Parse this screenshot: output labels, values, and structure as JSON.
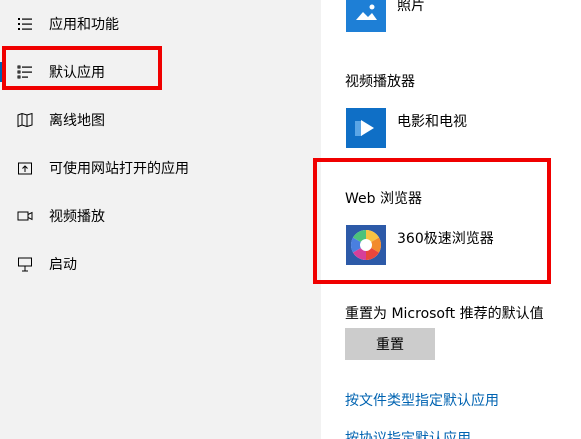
{
  "sidebar": {
    "items": [
      {
        "label": "应用和功能",
        "icon": "list-icon"
      },
      {
        "label": "默认应用",
        "icon": "default-apps-icon",
        "selected": true
      },
      {
        "label": "离线地图",
        "icon": "map-icon"
      },
      {
        "label": "可使用网站打开的应用",
        "icon": "open-website-icon"
      },
      {
        "label": "视频播放",
        "icon": "video-icon"
      },
      {
        "label": "启动",
        "icon": "startup-icon"
      }
    ]
  },
  "content": {
    "photos": {
      "app_label": "照片"
    },
    "video_player": {
      "section_label": "视频播放器",
      "app_label": "电影和电视"
    },
    "web_browser": {
      "section_label": "Web 浏览器",
      "app_label": "360极速浏览器"
    },
    "reset": {
      "label": "重置为 Microsoft 推荐的默认值",
      "button_label": "重置"
    },
    "links": {
      "by_file_type": "按文件类型指定默认应用",
      "by_protocol": "按协议指定默认应用"
    }
  },
  "colors": {
    "accent": "#0063b1",
    "highlight_box": "#f00000",
    "sidebar_bg": "#f2f2f2"
  }
}
